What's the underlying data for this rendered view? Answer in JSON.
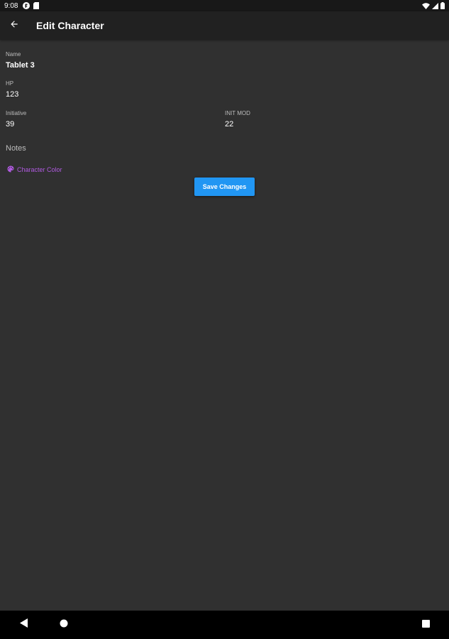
{
  "status_bar": {
    "time": "9:08",
    "icons": [
      "app-notification-icon",
      "sim-card-icon",
      "wifi-icon",
      "signal-icon",
      "battery-icon"
    ]
  },
  "app_bar": {
    "back_icon": "arrow-back-icon",
    "title": "Edit Character"
  },
  "form": {
    "name": {
      "label": "Name",
      "value": "Tablet 3"
    },
    "hp": {
      "label": "HP",
      "value": "123"
    },
    "initiative": {
      "label": "Initiative",
      "value": "39"
    },
    "init_mod": {
      "label": "INIT MOD",
      "value": "22"
    },
    "notes": {
      "label": "Notes"
    },
    "character_color": {
      "label": "Character Color",
      "icon": "palette-icon"
    },
    "save_button": {
      "label": "Save Changes"
    }
  },
  "nav_bar": {
    "icons": [
      "back-triangle-icon",
      "home-circle-icon",
      "recents-square-icon"
    ]
  },
  "colors": {
    "background": "#303030",
    "app_bar": "#212121",
    "accent": "#2196f3",
    "color_link": "#b05ae0"
  }
}
